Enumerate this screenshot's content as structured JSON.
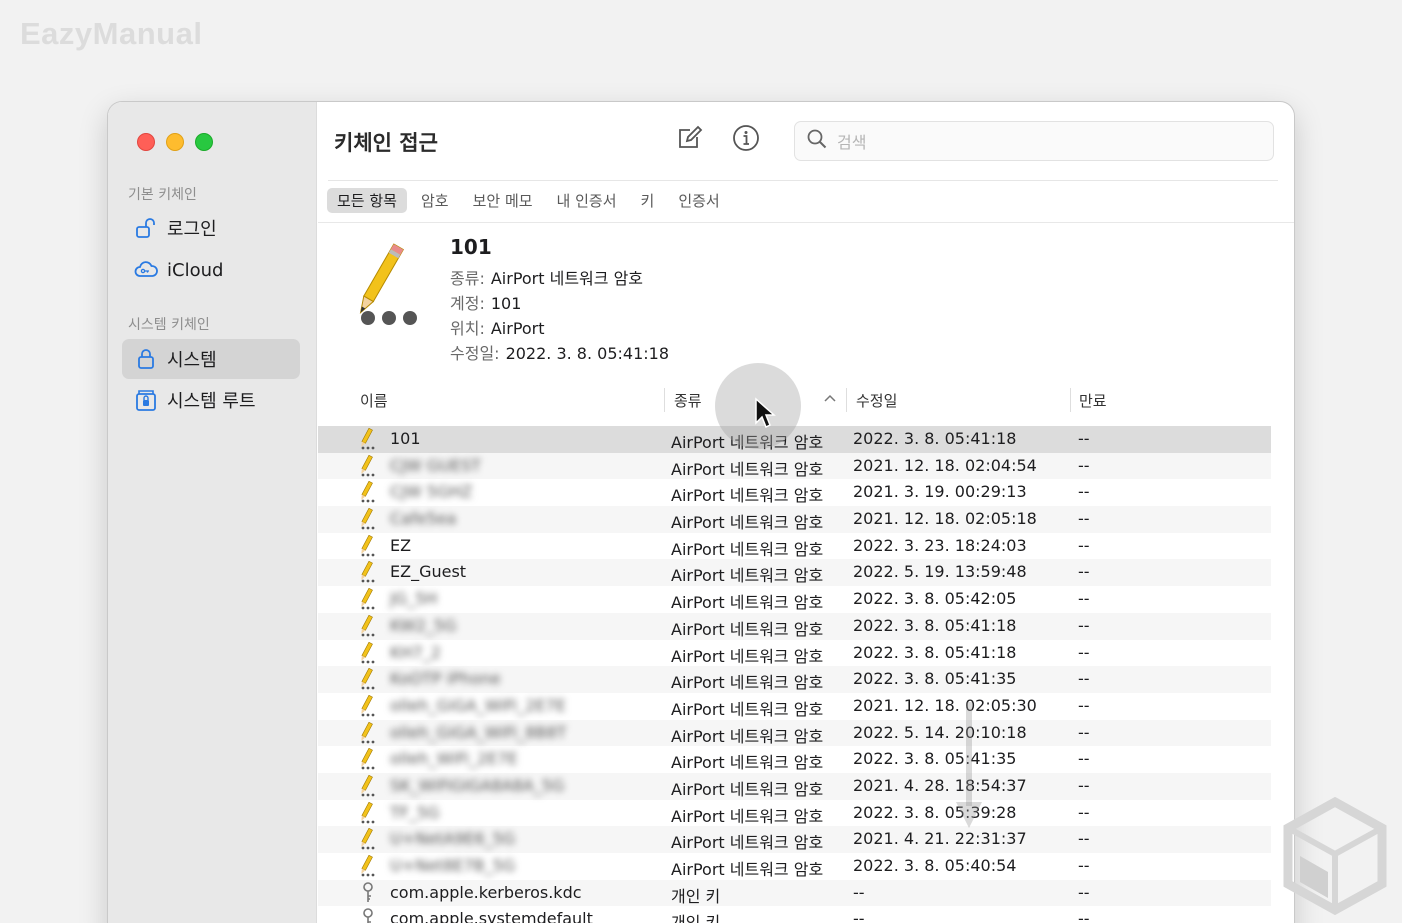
{
  "watermark": "EazyManual",
  "sidebar": {
    "heading_default": "기본 키체인",
    "heading_system": "시스템 키체인",
    "items": [
      {
        "label": "로그인",
        "icon": "unlock-icon"
      },
      {
        "label": "iCloud",
        "icon": "cloud-icon"
      },
      {
        "label": "시스템",
        "icon": "lock-icon",
        "selected": true
      },
      {
        "label": "시스템 루트",
        "icon": "cabinet-lock-icon"
      }
    ]
  },
  "toolbar": {
    "title": "키체인 접근",
    "search_placeholder": "검색"
  },
  "tabs": [
    "모든 항목",
    "암호",
    "보안 메모",
    "내 인증서",
    "키",
    "인증서"
  ],
  "detail": {
    "name": "101",
    "kind_label": "종류:",
    "kind_value": "AirPort 네트워크 암호",
    "account_label": "계정:",
    "account_value": "101",
    "where_label": "위치:",
    "where_value": "AirPort",
    "modified_label": "수정일:",
    "modified_value": "2022. 3. 8. 05:41:18"
  },
  "columns": {
    "name": "이름",
    "kind": "종류",
    "modified": "수정일",
    "expires": "만료"
  },
  "rows": [
    {
      "name": "101",
      "kind": "AirPort 네트워크 암호",
      "date": "2022. 3. 8. 05:41:18",
      "exp": "--",
      "icon": "password-icon"
    },
    {
      "name": "CJW GUEST",
      "kind": "AirPort 네트워크 암호",
      "date": "2021. 12. 18. 02:04:54",
      "exp": "--",
      "icon": "password-icon"
    },
    {
      "name": "CJW 5GHZ",
      "kind": "AirPort 네트워크 암호",
      "date": "2021. 3. 19. 00:29:13",
      "exp": "--",
      "icon": "password-icon"
    },
    {
      "name": "Cafe5ea",
      "kind": "AirPort 네트워크 암호",
      "date": "2021. 12. 18. 02:05:18",
      "exp": "--",
      "icon": "password-icon"
    },
    {
      "name": "EZ",
      "kind": "AirPort 네트워크 암호",
      "date": "2022. 3. 23. 18:24:03",
      "exp": "--",
      "icon": "password-icon"
    },
    {
      "name": "EZ_Guest",
      "kind": "AirPort 네트워크 암호",
      "date": "2022. 5. 19. 13:59:48",
      "exp": "--",
      "icon": "password-icon"
    },
    {
      "name": "JG_5H",
      "kind": "AirPort 네트워크 암호",
      "date": "2022. 3. 8. 05:42:05",
      "exp": "--",
      "icon": "password-icon"
    },
    {
      "name": "KW2_5G",
      "kind": "AirPort 네트워크 암호",
      "date": "2022. 3. 8. 05:41:18",
      "exp": "--",
      "icon": "password-icon"
    },
    {
      "name": "KH7_2",
      "kind": "AirPort 네트워크 암호",
      "date": "2022. 3. 8. 05:41:18",
      "exp": "--",
      "icon": "password-icon"
    },
    {
      "name": "KoOTP iPhone",
      "kind": "AirPort 네트워크 암호",
      "date": "2022. 3. 8. 05:41:35",
      "exp": "--",
      "icon": "password-icon"
    },
    {
      "name": "olleh_GiGA_WiFi_2E7E",
      "kind": "AirPort 네트워크 암호",
      "date": "2021. 12. 18. 02:05:30",
      "exp": "--",
      "icon": "password-icon"
    },
    {
      "name": "olleh_GiGA_WiFi_8B8T",
      "kind": "AirPort 네트워크 암호",
      "date": "2022. 5. 14. 20:10:18",
      "exp": "--",
      "icon": "password-icon"
    },
    {
      "name": "olleh_WiFi_2E7E",
      "kind": "AirPort 네트워크 암호",
      "date": "2022. 3. 8. 05:41:35",
      "exp": "--",
      "icon": "password-icon"
    },
    {
      "name": "SK_WiFiGIGA8A8A_5G",
      "kind": "AirPort 네트워크 암호",
      "date": "2021. 4. 28. 18:54:37",
      "exp": "--",
      "icon": "password-icon"
    },
    {
      "name": "TF_5G",
      "kind": "AirPort 네트워크 암호",
      "date": "2022. 3. 8. 05:39:28",
      "exp": "--",
      "icon": "password-icon"
    },
    {
      "name": "U+NetA9E6_5G",
      "kind": "AirPort 네트워크 암호",
      "date": "2021. 4. 21. 22:31:37",
      "exp": "--",
      "icon": "password-icon"
    },
    {
      "name": "U+Net8E7B_5G",
      "kind": "AirPort 네트워크 암호",
      "date": "2022. 3. 8. 05:40:54",
      "exp": "--",
      "icon": "password-icon"
    },
    {
      "name": "com.apple.kerberos.kdc",
      "kind": "개인 키",
      "date": "--",
      "exp": "--",
      "icon": "key-icon"
    },
    {
      "name": "com.apple.systemdefault",
      "kind": "개인 키",
      "date": "--",
      "exp": "--",
      "icon": "key-icon"
    }
  ]
}
